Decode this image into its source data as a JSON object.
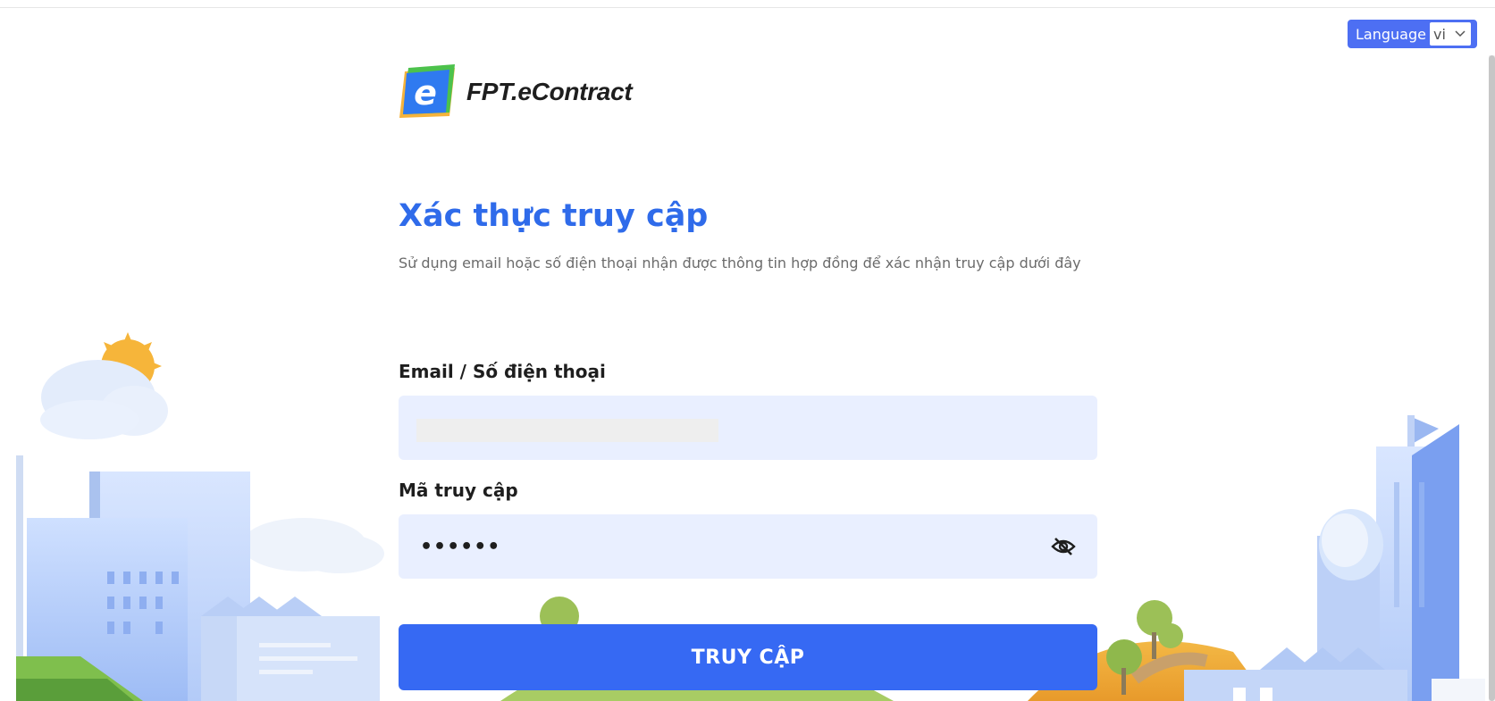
{
  "language": {
    "label": "Language",
    "selected": "vi"
  },
  "brand": {
    "name": "FPT.eContract",
    "primary_color": "#2f6bea",
    "button_color": "#3669f3"
  },
  "auth": {
    "title": "Xác thực truy cập",
    "subtitle": "Sử dụng email hoặc số điện thoại nhận được thông tin hợp đồng để xác nhận truy cập dưới đây",
    "email_label": "Email / Số điện thoại",
    "email_value": "",
    "code_label": "Mã truy cập",
    "code_value": "••••••",
    "submit_label": "TRUY CẬP"
  },
  "icons": {
    "toggle_visibility": "eye-off-icon",
    "language_dropdown": "chevron-down-icon"
  }
}
